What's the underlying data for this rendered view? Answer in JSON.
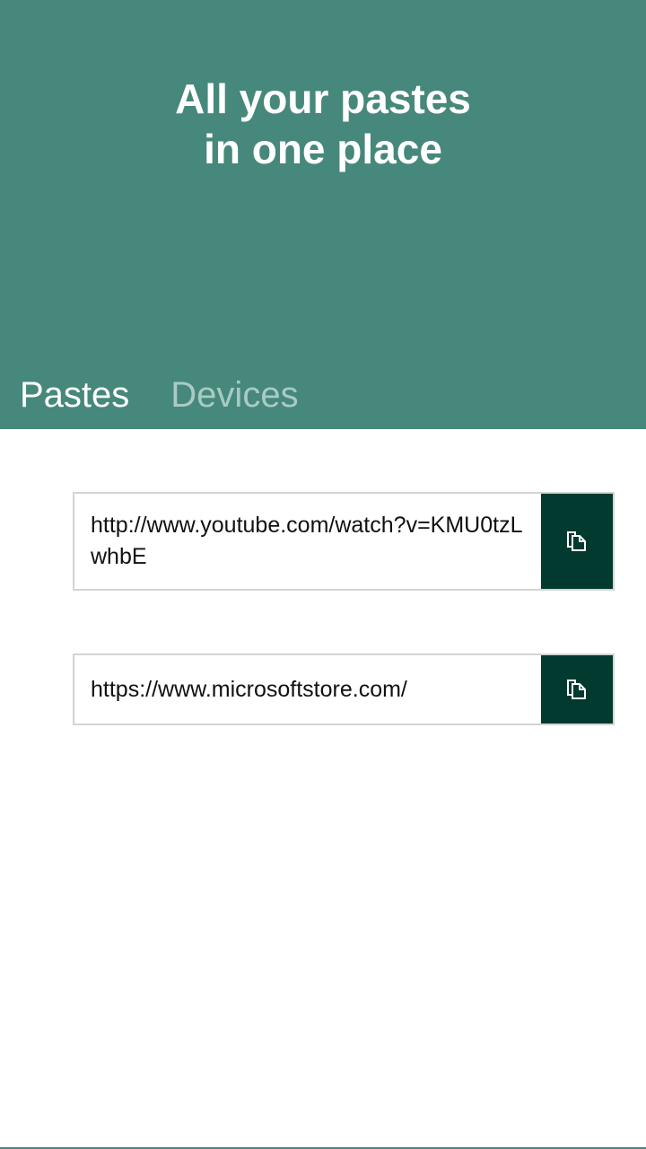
{
  "hero": {
    "title_line1": "All your pastes",
    "title_line2": "in one place"
  },
  "tabs": [
    {
      "label": "Pastes",
      "active": true
    },
    {
      "label": "Devices",
      "active": false
    }
  ],
  "pastes": [
    {
      "text": "http://www.youtube.com/watch?v=KMU0tzLwhbE",
      "icon": "copy-icon"
    },
    {
      "text": "https://www.microsoftstore.com/",
      "icon": "copy-icon"
    }
  ],
  "colors": {
    "header_bg": "#46887b",
    "button_bg": "#023a30",
    "inactive_tab": "#a8cbc3"
  }
}
